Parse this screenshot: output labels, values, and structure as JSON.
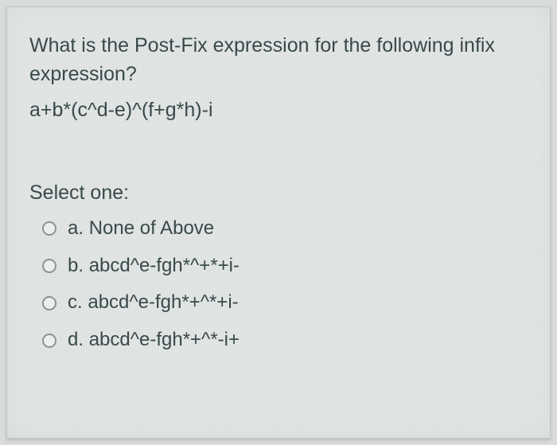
{
  "question": {
    "prompt": "What is the Post-Fix expression for the following infix expression?",
    "expression": "a+b*(c^d-e)^(f+g*h)-i"
  },
  "select_label": "Select one:",
  "options": [
    {
      "letter": "a.",
      "text": "None of Above"
    },
    {
      "letter": "b.",
      "text": "abcd^e-fgh*^+*+i-"
    },
    {
      "letter": "c.",
      "text": "abcd^e-fgh*+^*+i-"
    },
    {
      "letter": "d.",
      "text": "abcd^e-fgh*+^*-i+"
    }
  ]
}
